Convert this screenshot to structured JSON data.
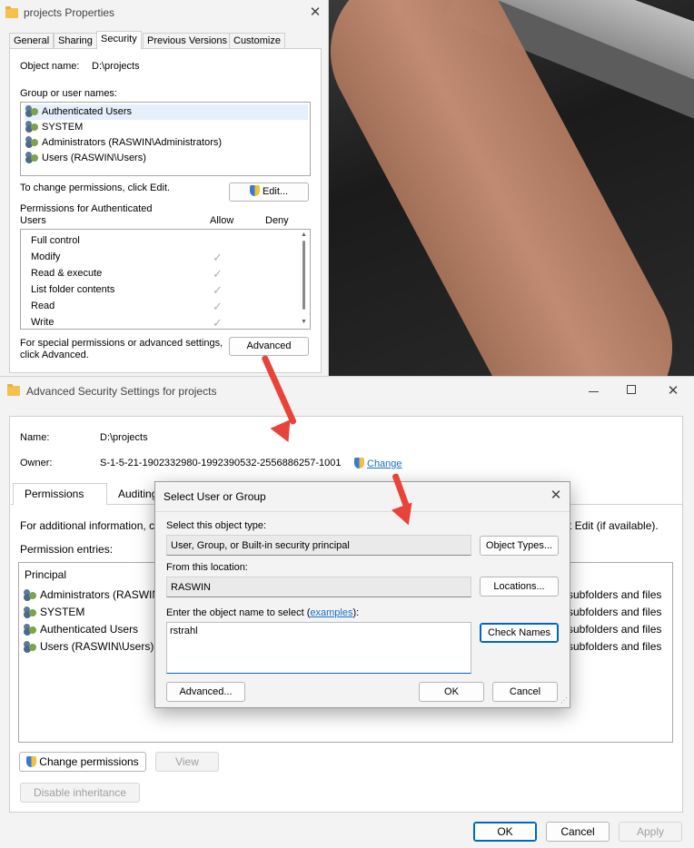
{
  "props": {
    "title": "projects Properties",
    "tabs": [
      "General",
      "Sharing",
      "Security",
      "Previous Versions",
      "Customize"
    ],
    "object_name_label": "Object name:",
    "object_name_value": "D:\\projects",
    "group_label": "Group or user names:",
    "users": [
      "Authenticated Users",
      "SYSTEM",
      "Administrators (RASWIN\\Administrators)",
      "Users (RASWIN\\Users)"
    ],
    "change_hint": "To change permissions, click Edit.",
    "edit_button": "Edit...",
    "perm_label_line1": "Permissions for Authenticated",
    "perm_label_line2": "Users",
    "allow_header": "Allow",
    "deny_header": "Deny",
    "permissions": [
      "Full control",
      "Modify",
      "Read & execute",
      "List folder contents",
      "Read",
      "Write"
    ],
    "special_line1": "For special permissions or advanced settings,",
    "special_line2": "click Advanced.",
    "advanced_button": "Advanced"
  },
  "adv": {
    "title": "Advanced Security Settings for projects",
    "name_label": "Name:",
    "name_value": "D:\\projects",
    "owner_label": "Owner:",
    "owner_value": "S-1-5-21-1902332980-1992390532-2556886257-1001",
    "change_link": "Change",
    "tabs": [
      "Permissions",
      "Auditing"
    ],
    "info_text": "For additional information, c",
    "info_tail": "t Edit (if available).",
    "entries_label": "Permission entries:",
    "principal_header": "Principal",
    "principals": [
      "Administrators (RASWIN",
      "SYSTEM",
      "Authenticated Users",
      "Users (RASWIN\\Users)"
    ],
    "applies": [
      "subfolders and files",
      "subfolders and files",
      "subfolders and files",
      "subfolders and files"
    ],
    "change_perm_button": "Change permissions",
    "view_button": "View",
    "disable_inherit_button": "Disable inheritance",
    "ok": "OK",
    "cancel": "Cancel",
    "apply": "Apply"
  },
  "dialog": {
    "title": "Select User or Group",
    "object_type_label": "Select this object type:",
    "object_type_value": "User, Group, or Built-in security principal",
    "object_types_button": "Object Types...",
    "location_label": "From this location:",
    "location_value": "RASWIN",
    "locations_button": "Locations...",
    "enter_label_pre": "Enter the object name to select (",
    "examples_link": "examples",
    "enter_label_post": "):",
    "name_value": "rstrahl",
    "check_names_button": "Check Names",
    "advanced_button": "Advanced...",
    "ok": "OK",
    "cancel": "Cancel"
  },
  "colors": {
    "accent": "#0067c0",
    "arrow": "#e8433a",
    "link": "#1a6fc4"
  }
}
